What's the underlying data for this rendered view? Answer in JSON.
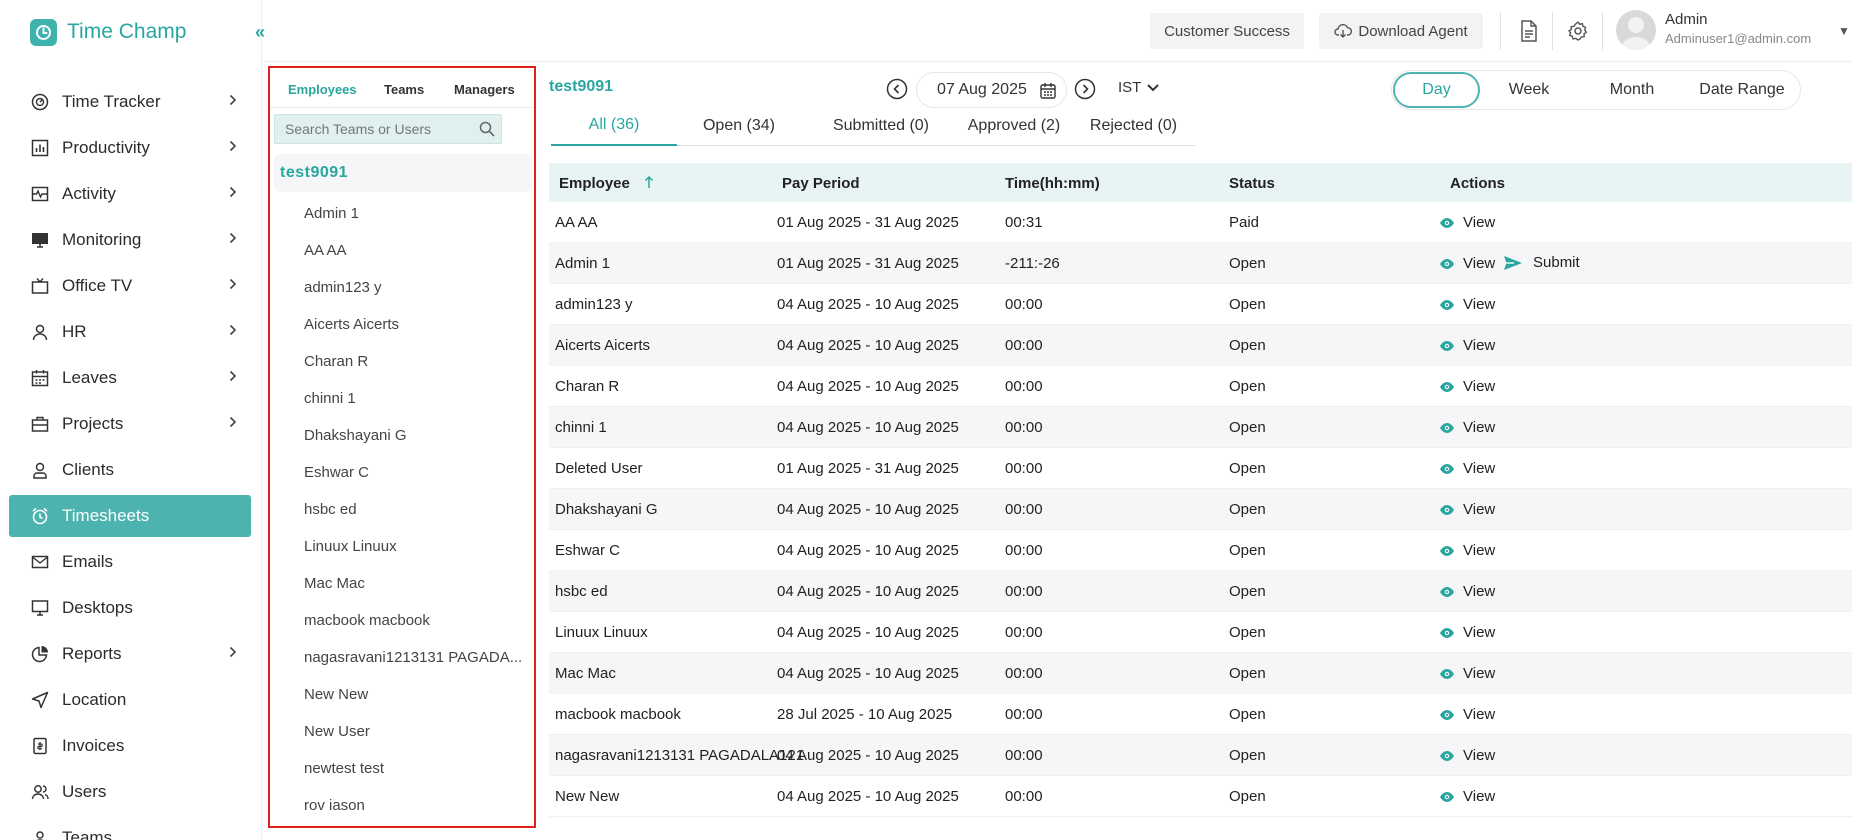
{
  "app": {
    "name": "Time Champ"
  },
  "colors": {
    "accent": "#4db3ae",
    "accent_text": "#2aa6a0",
    "highlight_border": "#e0201f"
  },
  "sidebar": {
    "items": [
      {
        "label": "Time Tracker",
        "icon": "clock-gauge-icon",
        "chevron": true
      },
      {
        "label": "Productivity",
        "icon": "bar-chart-icon",
        "chevron": true
      },
      {
        "label": "Activity",
        "icon": "activity-icon",
        "chevron": true
      },
      {
        "label": "Monitoring",
        "icon": "monitor-icon",
        "chevron": true
      },
      {
        "label": "Office TV",
        "icon": "tv-icon",
        "chevron": true
      },
      {
        "label": "HR",
        "icon": "person-icon",
        "chevron": true
      },
      {
        "label": "Leaves",
        "icon": "calendar-icon",
        "chevron": true
      },
      {
        "label": "Projects",
        "icon": "briefcase-icon",
        "chevron": true
      },
      {
        "label": "Clients",
        "icon": "client-icon",
        "chevron": false
      },
      {
        "label": "Timesheets",
        "icon": "alarm-clock-icon",
        "chevron": false,
        "active": true
      },
      {
        "label": "Emails",
        "icon": "mail-icon",
        "chevron": false
      },
      {
        "label": "Desktops",
        "icon": "desktop-icon",
        "chevron": false
      },
      {
        "label": "Reports",
        "icon": "pie-chart-icon",
        "chevron": true
      },
      {
        "label": "Location",
        "icon": "location-arrow-icon",
        "chevron": false
      },
      {
        "label": "Invoices",
        "icon": "invoice-icon",
        "chevron": false
      },
      {
        "label": "Users",
        "icon": "users-icon",
        "chevron": false
      },
      {
        "label": "Teams",
        "icon": "teams-icon",
        "chevron": false
      }
    ]
  },
  "topbar": {
    "customer_success": "Customer Success",
    "download_agent": "Download Agent",
    "user_name": "Admin",
    "user_email": "Adminuser1@admin.com"
  },
  "employee_panel": {
    "tabs": [
      "Employees",
      "Teams",
      "Managers"
    ],
    "search_placeholder": "Search Teams or Users",
    "team_name": "test9091",
    "employees": [
      "Admin 1",
      "AA AA",
      "admin123 y",
      "Aicerts Aicerts",
      "Charan R",
      "chinni 1",
      "Dhakshayani G",
      "Eshwar C",
      "hsbc ed",
      "Linuux Linuux",
      "Mac Mac",
      "macbook macbook",
      "nagasravani1213131 PAGADA...",
      "New New",
      "New User",
      "newtest test",
      "rov iason"
    ]
  },
  "main": {
    "team_title": "test9091",
    "date": "07 Aug 2025",
    "timezone": "IST",
    "range_options": [
      "Day",
      "Week",
      "Month",
      "Date Range"
    ],
    "status_tabs": [
      "All (36)",
      "Open (34)",
      "Submitted (0)",
      "Approved (2)",
      "Rejected (0)"
    ]
  },
  "table": {
    "headers": [
      "Employee",
      "Pay Period",
      "Time(hh:mm)",
      "Status",
      "Actions"
    ],
    "view_label": "View",
    "submit_label": "Submit",
    "rows": [
      {
        "employee": "AA AA",
        "period": "01 Aug 2025 - 31 Aug 2025",
        "time": "00:31",
        "status": "Paid",
        "submit": false
      },
      {
        "employee": "Admin 1",
        "period": "01 Aug 2025 - 31 Aug 2025",
        "time": "-211:-26",
        "status": "Open",
        "submit": true
      },
      {
        "employee": "admin123 y",
        "period": "04 Aug 2025 - 10 Aug 2025",
        "time": "00:00",
        "status": "Open",
        "submit": false
      },
      {
        "employee": "Aicerts Aicerts",
        "period": "04 Aug 2025 - 10 Aug 2025",
        "time": "00:00",
        "status": "Open",
        "submit": false
      },
      {
        "employee": "Charan R",
        "period": "04 Aug 2025 - 10 Aug 2025",
        "time": "00:00",
        "status": "Open",
        "submit": false
      },
      {
        "employee": "chinni 1",
        "period": "04 Aug 2025 - 10 Aug 2025",
        "time": "00:00",
        "status": "Open",
        "submit": false
      },
      {
        "employee": "Deleted User",
        "period": "01 Aug 2025 - 31 Aug 2025",
        "time": "00:00",
        "status": "Open",
        "submit": false
      },
      {
        "employee": "Dhakshayani G",
        "period": "04 Aug 2025 - 10 Aug 2025",
        "time": "00:00",
        "status": "Open",
        "submit": false
      },
      {
        "employee": "Eshwar C",
        "period": "04 Aug 2025 - 10 Aug 2025",
        "time": "00:00",
        "status": "Open",
        "submit": false
      },
      {
        "employee": "hsbc ed",
        "period": "04 Aug 2025 - 10 Aug 2025",
        "time": "00:00",
        "status": "Open",
        "submit": false
      },
      {
        "employee": "Linuux Linuux",
        "period": "04 Aug 2025 - 10 Aug 2025",
        "time": "00:00",
        "status": "Open",
        "submit": false
      },
      {
        "employee": "Mac Mac",
        "period": "04 Aug 2025 - 10 Aug 2025",
        "time": "00:00",
        "status": "Open",
        "submit": false
      },
      {
        "employee": "macbook macbook",
        "period": "28 Jul 2025 - 10 Aug 2025",
        "time": "00:00",
        "status": "Open",
        "submit": false
      },
      {
        "employee": "nagasravani1213131 PAGADALA121",
        "period": "04 Aug 2025 - 10 Aug 2025",
        "time": "00:00",
        "status": "Open",
        "submit": false
      },
      {
        "employee": "New New",
        "period": "04 Aug 2025 - 10 Aug 2025",
        "time": "00:00",
        "status": "Open",
        "submit": false
      }
    ]
  }
}
